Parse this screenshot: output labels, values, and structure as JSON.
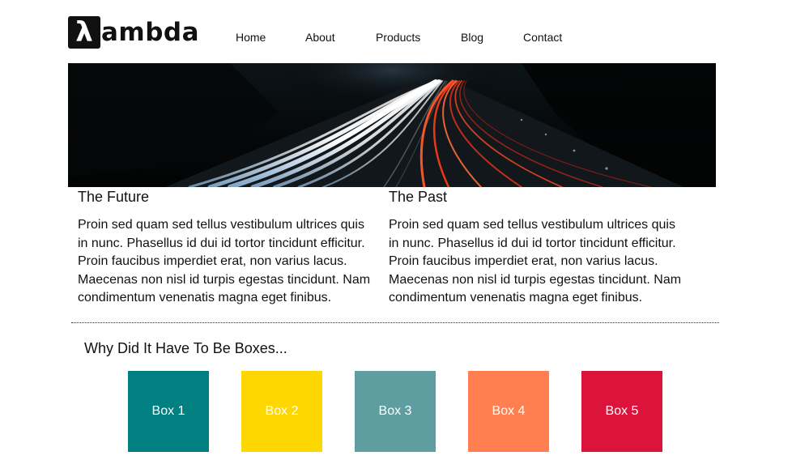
{
  "header": {
    "logo_letter": "λ",
    "logo_text": "ambda",
    "nav": [
      {
        "label": "Home"
      },
      {
        "label": "About"
      },
      {
        "label": "Products"
      },
      {
        "label": "Blog"
      },
      {
        "label": "Contact"
      }
    ]
  },
  "hero": {
    "description_icon": "highway-light-trails-image"
  },
  "columns": [
    {
      "title": "The Future",
      "body": "Proin sed quam sed tellus vestibulum ultrices quis in nunc. Phasellus id dui id tortor tincidunt efficitur. Proin faucibus imperdiet erat, non varius lacus. Maecenas non nisl id turpis egestas tincidunt. Nam condimentum venenatis magna eget finibus."
    },
    {
      "title": "The Past",
      "body": "Proin sed quam sed tellus vestibulum ultrices quis in nunc. Phasellus id dui id tortor tincidunt efficitur. Proin faucibus imperdiet erat, non varius lacus. Maecenas non nisl id turpis egestas tincidunt. Nam condimentum venenatis magna eget finibus."
    }
  ],
  "boxes_section": {
    "title": "Why Did It Have To Be Boxes...",
    "boxes": [
      {
        "label": "Box 1",
        "color": "#008080"
      },
      {
        "label": "Box 2",
        "color": "#FFD700"
      },
      {
        "label": "Box 3",
        "color": "#5F9EA0"
      },
      {
        "label": "Box 4",
        "color": "#FF7F50"
      },
      {
        "label": "Box 5",
        "color": "#DC143C"
      }
    ]
  }
}
